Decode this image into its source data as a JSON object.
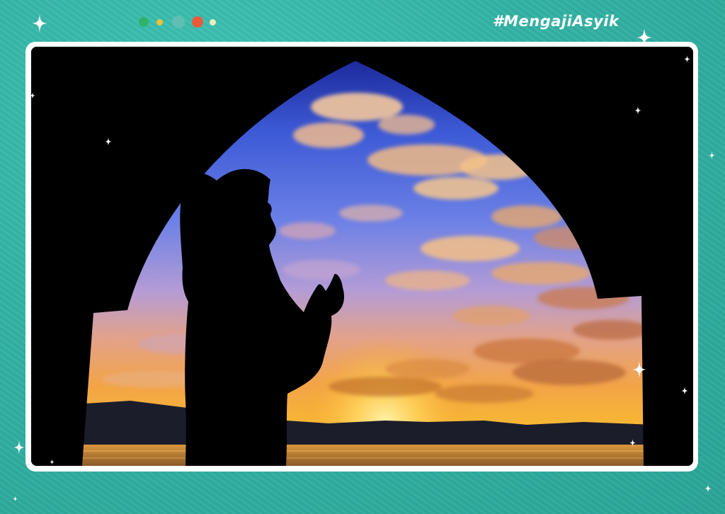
{
  "header": {
    "hashtag_part1": "#Mengaji",
    "hashtag_part2": "Asyik",
    "window_dots": [
      {
        "name": "green-dot",
        "color": "#2fb36a"
      },
      {
        "name": "yellow-dot",
        "color": "#f1c232"
      },
      {
        "name": "grey-dot",
        "color": "#5fbfb2"
      },
      {
        "name": "orange-dot",
        "color": "#ea5a3a"
      },
      {
        "name": "cream-dot",
        "color": "#e9edc4"
      }
    ]
  },
  "photo": {
    "subject": "silhouette-praying-woman-icon",
    "arch": "mosque-arch-silhouette-icon",
    "sky_colors": [
      "#1d2a9c",
      "#3d5ad6",
      "#6b80e6",
      "#d98fa8",
      "#f3a447",
      "#f7b733"
    ],
    "water_color": "#c8893a",
    "hills_color": "#1b1d2b"
  },
  "colors": {
    "background": "#33b3a5",
    "frame": "#ffffff",
    "sparkle": "#ffffff"
  }
}
